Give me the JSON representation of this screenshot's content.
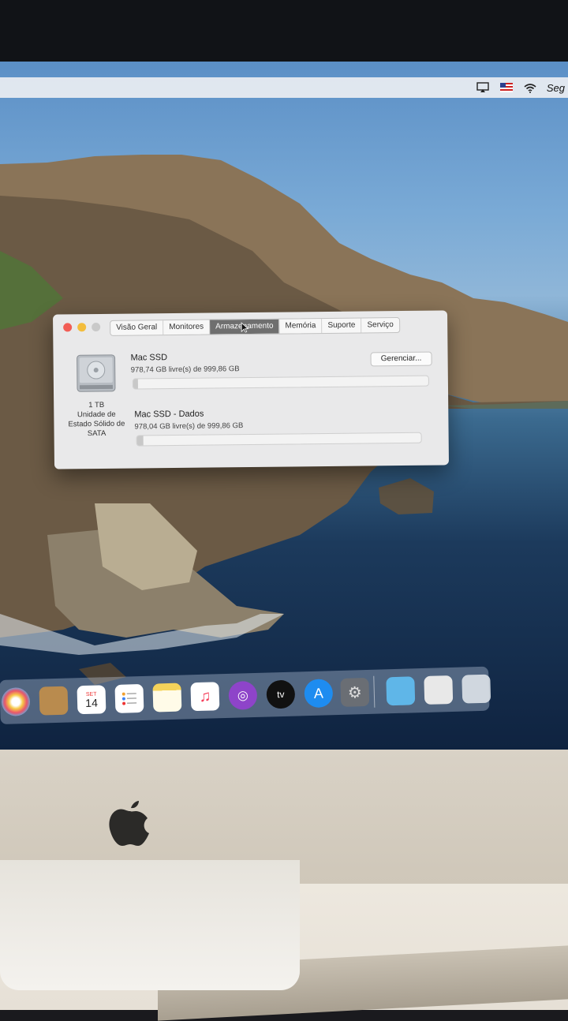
{
  "menubar": {
    "clock": "Seg",
    "icons": [
      "airplay-icon",
      "us-flag-icon",
      "wifi-icon"
    ]
  },
  "window": {
    "tabs": [
      {
        "label": "Visão Geral",
        "active": false
      },
      {
        "label": "Monitores",
        "active": false
      },
      {
        "label": "Armazenamento",
        "active": true
      },
      {
        "label": "Memória",
        "active": false
      },
      {
        "label": "Suporte",
        "active": false
      },
      {
        "label": "Serviço",
        "active": false
      }
    ],
    "drive": {
      "capacity": "1 TB",
      "type_line1": "Unidade de",
      "type_line2": "Estado Sólido de",
      "type_line3": "SATA"
    },
    "manage_label": "Gerenciar...",
    "volumes": [
      {
        "name": "Mac SSD",
        "free": "978,74 GB livre(s) de 999,86 GB",
        "used_fraction": 0.011
      },
      {
        "name": "Mac SSD - Dados",
        "free": "978,04 GB livre(s) de 999,86 GB",
        "used_fraction": 0.022
      }
    ]
  },
  "dock": {
    "items": [
      "photos-icon",
      "contacts-icon",
      "calendar-icon",
      "reminders-icon",
      "notes-icon",
      "music-icon",
      "podcasts-icon",
      "apple-tv-icon",
      "app-store-icon",
      "system-preferences-icon",
      "downloads-folder-icon",
      "preview-icon",
      "trash-icon"
    ],
    "calendar_month": "SET",
    "calendar_day": "14",
    "tv_label": "tv"
  },
  "colors": {
    "close": "#f25d55",
    "minimize": "#f3bd3c",
    "active_tab": "#6f6f6f"
  }
}
